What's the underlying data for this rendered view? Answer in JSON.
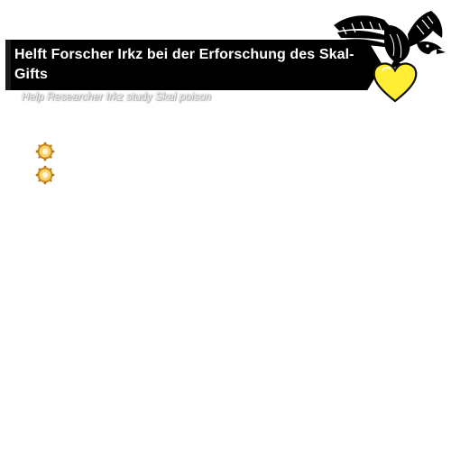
{
  "quest": {
    "title": "Helft Forscher Irkz bei der Erforschung des Skal-Gifts",
    "subtitle": "Help Researcher Irkz study Skal poison",
    "objectives": [
      {
        "icon": "gold-sun-icon",
        "text": ""
      },
      {
        "icon": "gold-sun-icon",
        "text": ""
      }
    ]
  },
  "emblem": {
    "icon": "eagle-icon"
  },
  "favorite": {
    "icon": "heart-icon",
    "color": "#ffee33"
  },
  "colors": {
    "banner": "#000000",
    "title_text": "#ffffff",
    "objective_gold": "#e0a020"
  }
}
